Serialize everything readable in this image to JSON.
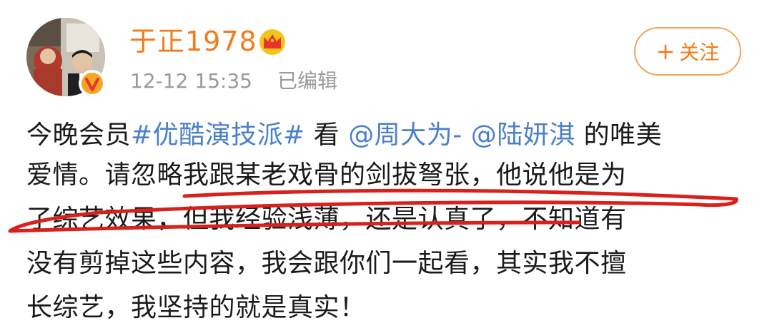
{
  "user": {
    "name": "于正1978",
    "avatar_icon": "profile-photo",
    "verified_icon": "verified-v-icon",
    "crown_icon": "crown-icon"
  },
  "meta": {
    "time": "12-12 15:35",
    "edited": "已编辑"
  },
  "follow": {
    "plus": "+",
    "label": "关注"
  },
  "post": {
    "line1": {
      "t1": "今晚会员",
      "hashtag": "#优酷演技派#",
      "t2": " 看 ",
      "mention1": "@周大为-",
      "t3": " ",
      "mention2": "@陆妍淇",
      "t4": " 的唯美"
    },
    "line2": "爱情。请忽略我跟某老戏骨的剑拔弩张，他说他是为",
    "line3": "了综艺效果，但我经验浅薄，还是认真了，不知道有",
    "line4": "没有剪掉这些内容，我会跟你们一起看，其实我不擅",
    "line5": "长综艺，我坚持的就是真实！"
  },
  "colors": {
    "username": "#f07c1b",
    "link": "#4a80c9",
    "meta": "#9a9a9a",
    "text": "#1a1a1a",
    "annotation": "#d8201c"
  }
}
